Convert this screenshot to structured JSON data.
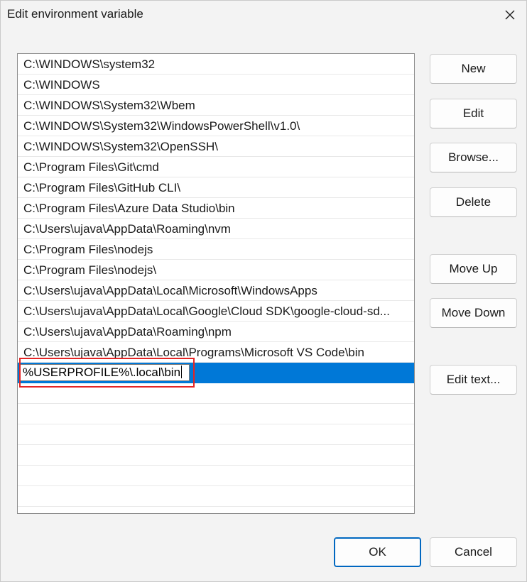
{
  "dialog": {
    "title": "Edit environment variable"
  },
  "path_list": {
    "items": [
      {
        "value": "C:\\WINDOWS\\system32"
      },
      {
        "value": "C:\\WINDOWS"
      },
      {
        "value": "C:\\WINDOWS\\System32\\Wbem"
      },
      {
        "value": "C:\\WINDOWS\\System32\\WindowsPowerShell\\v1.0\\"
      },
      {
        "value": "C:\\WINDOWS\\System32\\OpenSSH\\"
      },
      {
        "value": "C:\\Program Files\\Git\\cmd"
      },
      {
        "value": "C:\\Program Files\\GitHub CLI\\"
      },
      {
        "value": "C:\\Program Files\\Azure Data Studio\\bin"
      },
      {
        "value": "C:\\Users\\ujava\\AppData\\Roaming\\nvm"
      },
      {
        "value": "C:\\Program Files\\nodejs"
      },
      {
        "value": "C:\\Program Files\\nodejs\\"
      },
      {
        "value": "C:\\Users\\ujava\\AppData\\Local\\Microsoft\\WindowsApps"
      },
      {
        "value": "C:\\Users\\ujava\\AppData\\Local\\Google\\Cloud SDK\\google-cloud-sd..."
      },
      {
        "value": "C:\\Users\\ujava\\AppData\\Roaming\\npm"
      },
      {
        "value": "C:\\Users\\ujava\\AppData\\Local\\Programs\\Microsoft VS Code\\bin"
      }
    ],
    "editing_value": "%USERPROFILE%\\.local\\bin"
  },
  "buttons": {
    "new": "New",
    "edit": "Edit",
    "browse": "Browse...",
    "delete": "Delete",
    "move_up": "Move Up",
    "move_down": "Move Down",
    "edit_text": "Edit text...",
    "ok": "OK",
    "cancel": "Cancel"
  },
  "colors": {
    "selection": "#0078d7",
    "highlight_annotation": "#e52424",
    "default_button_border": "#0067c0"
  }
}
